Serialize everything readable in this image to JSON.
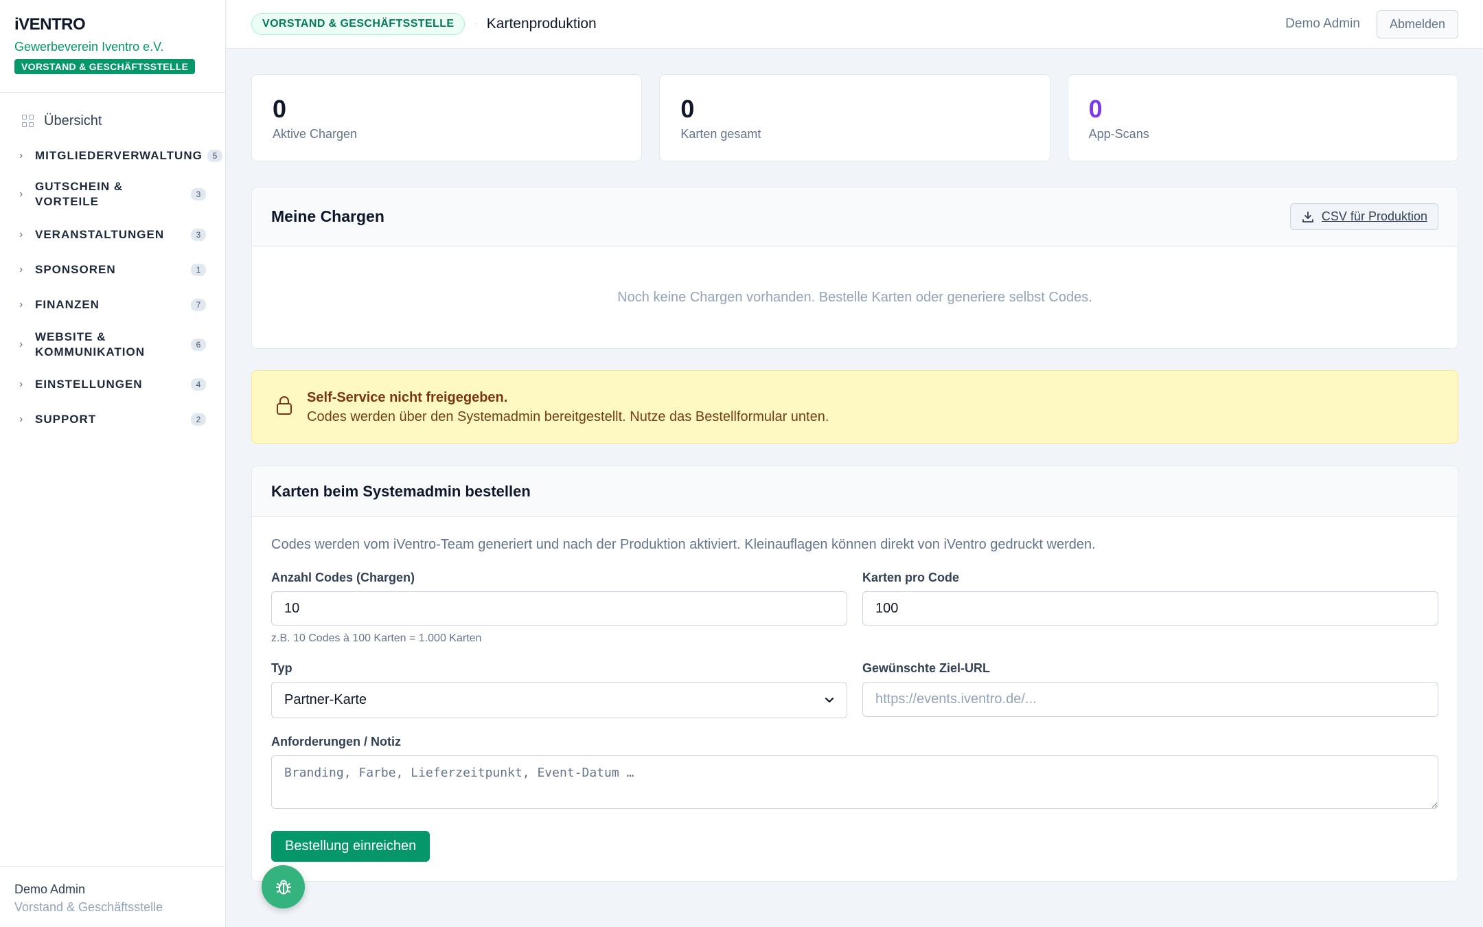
{
  "brand": {
    "logo": "iVENTRO",
    "org": "Gewerbeverein Iventro e.V.",
    "role_badge": "VORSTAND & GESCHÄFTSSTELLE"
  },
  "sidebar": {
    "overview": "Übersicht",
    "groups": [
      {
        "label": "MITGLIEDERVERWALTUNG",
        "count": "5"
      },
      {
        "label": "GUTSCHEIN & VORTEILE",
        "count": "3"
      },
      {
        "label": "VERANSTALTUNGEN",
        "count": "3"
      },
      {
        "label": "SPONSOREN",
        "count": "1"
      },
      {
        "label": "FINANZEN",
        "count": "7"
      },
      {
        "label": "WEBSITE & KOMMUNIKATION",
        "count": "6"
      },
      {
        "label": "EINSTELLUNGEN",
        "count": "4"
      },
      {
        "label": "SUPPORT",
        "count": "2"
      }
    ],
    "footer": {
      "name": "Demo Admin",
      "role": "Vorstand & Geschäftsstelle"
    }
  },
  "topbar": {
    "pill": "VORSTAND & GESCHÄFTSSTELLE",
    "separator": "·",
    "title": "Kartenproduktion",
    "user": "Demo Admin",
    "logout": "Abmelden"
  },
  "stats": [
    {
      "value": "0",
      "label": "Aktive Chargen"
    },
    {
      "value": "0",
      "label": "Karten gesamt"
    },
    {
      "value": "0",
      "label": "App-Scans"
    }
  ],
  "batches": {
    "title": "Meine Chargen",
    "csv_button": "CSV für Produktion",
    "empty": "Noch keine Chargen vorhanden. Bestelle Karten oder generiere selbst Codes."
  },
  "alert": {
    "title": "Self-Service nicht freigegeben.",
    "text": "Codes werden über den Systemadmin bereitgestellt. Nutze das Bestellformular unten."
  },
  "order": {
    "title": "Karten beim Systemadmin bestellen",
    "description": "Codes werden vom iVentro-Team generiert und nach der Produktion aktiviert. Kleinauflagen können direkt von iVentro gedruckt werden.",
    "codes_label": "Anzahl Codes (Chargen)",
    "codes_value": "10",
    "codes_hint": "z.B. 10 Codes à 100 Karten = 1.000 Karten",
    "cards_label": "Karten pro Code",
    "cards_value": "100",
    "type_label": "Typ",
    "type_value": "Partner-Karte",
    "url_label": "Gewünschte Ziel-URL",
    "url_placeholder": "https://events.iventro.de/...",
    "note_label": "Anforderungen / Notiz",
    "note_placeholder": "Branding, Farbe, Lieferzeitpunkt, Event-Datum …",
    "submit": "Bestellung einreichen"
  },
  "colors": {
    "accent": "#059669",
    "purple": "#7c3aed",
    "alert_bg": "#fef9c3"
  }
}
